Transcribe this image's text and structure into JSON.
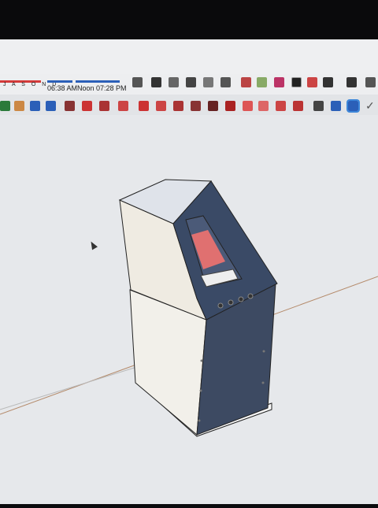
{
  "shadow_settings": {
    "months": "J A S O N D",
    "time_start": "06:38 AM",
    "time_noon": "Noon",
    "time_end": "07:28 PM"
  },
  "toolbar": {
    "check_label": "✓"
  },
  "colors": {
    "accent": "#3c86d9",
    "model_dark_panel": "#3d4a62",
    "model_light_face": "#eeeae0",
    "screen_red": "#e07070"
  },
  "icons": [
    "select-icon",
    "paint-bucket-icon",
    "eraser-icon",
    "tape-measure-icon",
    "dimension-icon",
    "orbit-icon",
    "pan-icon",
    "pencil-icon",
    "arc-icon",
    "rectangle-icon",
    "push-pull-icon",
    "offset-icon",
    "move-icon",
    "rotate-icon",
    "scale-icon",
    "component-icon",
    "house-icon",
    "front-view-icon",
    "back-view-icon",
    "solid-icon",
    "texture-icon",
    "sandbox-icon",
    "section-plane-icon",
    "xray-icon",
    "warehouse-icon"
  ]
}
